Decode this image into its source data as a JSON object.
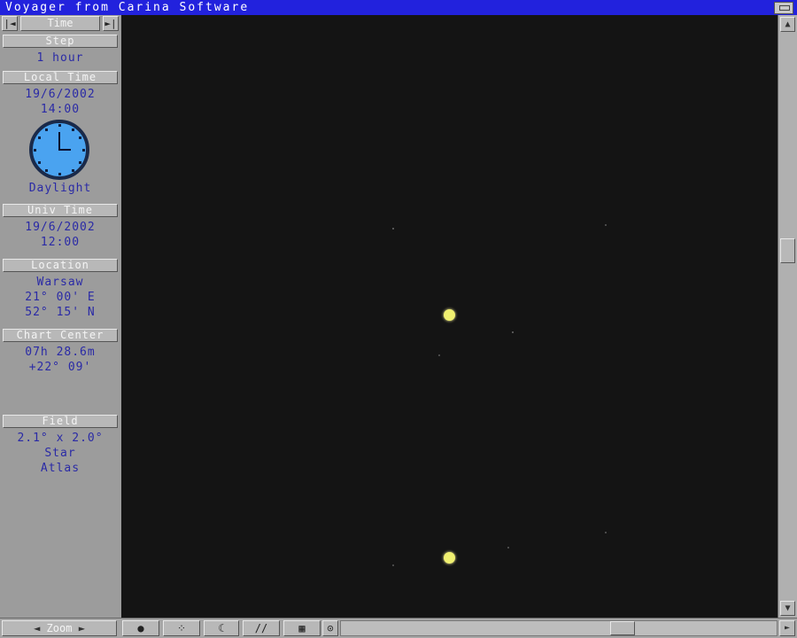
{
  "window": {
    "title": "Voyager from Carina Software"
  },
  "sidebar": {
    "time": {
      "prev": "|◄",
      "label": "Time",
      "next": "►|"
    },
    "step": {
      "header": "Step",
      "value": "1 hour"
    },
    "local_time": {
      "header": "Local Time",
      "date": "19/6/2002",
      "time": "14:00",
      "status": "Daylight"
    },
    "univ_time": {
      "header": "Univ Time",
      "date": "19/6/2002",
      "time": "12:00"
    },
    "location": {
      "header": "Location",
      "name": "Warsaw",
      "longitude": "21° 00' E",
      "latitude": "52° 15' N"
    },
    "chart_center": {
      "header": "Chart Center",
      "ra": "07h 28.6m",
      "dec": "+22° 09'"
    },
    "field": {
      "header": "Field",
      "size": "2.1° x 2.0°",
      "mode_line1": "Star",
      "mode_line2": "Atlas"
    }
  },
  "toolbar": {
    "zoom_label": "Zoom",
    "zoom_minus": "◄",
    "zoom_plus": "►",
    "tools": [
      "●",
      "⁘",
      "☾",
      "//",
      "▦",
      "⊙"
    ]
  },
  "scrollbars": {
    "up": "▲",
    "down": "▼",
    "right": "►"
  },
  "colors": {
    "title_bar": "#2222dd",
    "panel_text": "#2a2aa6",
    "sky": "#141414",
    "planet": "#f0f070",
    "clock_face": "#4aa3f0"
  }
}
